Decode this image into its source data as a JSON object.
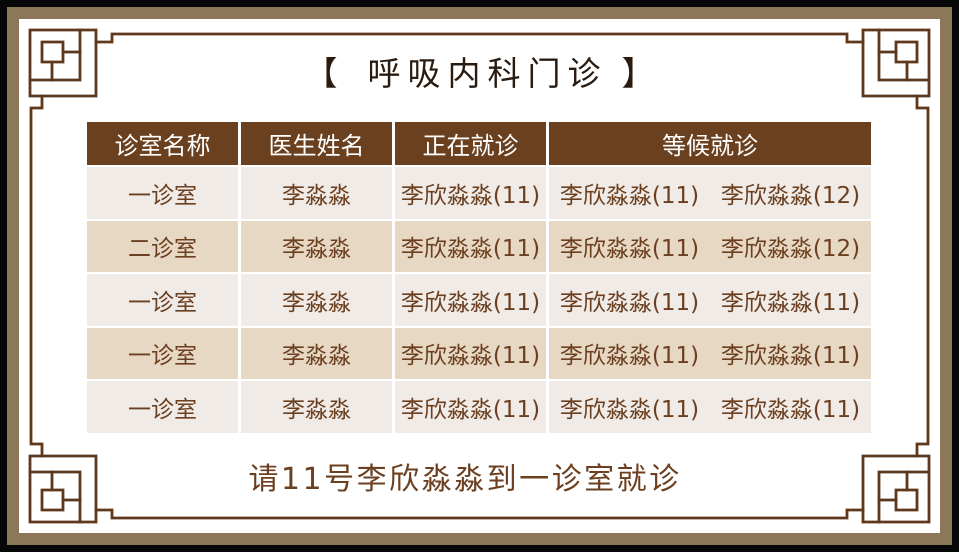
{
  "title": {
    "open_bracket": "【",
    "text": "呼吸内科门诊",
    "close_bracket": "】"
  },
  "table": {
    "columns": [
      "诊室名称",
      "医生姓名",
      "正在就诊",
      "等候就诊"
    ],
    "rows": [
      {
        "room": "一诊室",
        "doctor": "李淼淼",
        "current": "李欣淼淼(11)",
        "waiting": [
          "李欣淼淼(11)",
          "李欣淼淼(12)"
        ]
      },
      {
        "room": "二诊室",
        "doctor": "李淼淼",
        "current": "李欣淼淼(11)",
        "waiting": [
          "李欣淼淼(11)",
          "李欣淼淼(12)"
        ]
      },
      {
        "room": "一诊室",
        "doctor": "李淼淼",
        "current": "李欣淼淼(11)",
        "waiting": [
          "李欣淼淼(11)",
          "李欣淼淼(11)"
        ]
      },
      {
        "room": "一诊室",
        "doctor": "李淼淼",
        "current": "李欣淼淼(11)",
        "waiting": [
          "李欣淼淼(11)",
          "李欣淼淼(11)"
        ]
      },
      {
        "room": "一诊室",
        "doctor": "李淼淼",
        "current": "李欣淼淼(11)",
        "waiting": [
          "李欣淼淼(11)",
          "李欣淼淼(11)"
        ]
      }
    ]
  },
  "call_message": "请11号李欣淼淼到一诊室就诊",
  "colors": {
    "outer_border": "#080808",
    "band": "#8c7759",
    "panel": "#ffffff",
    "frame_line": "#5c391c",
    "title_text": "#2a1b11",
    "header_bg": "#6b401f",
    "header_text": "#ffffff",
    "body_text": "#6b3f1f",
    "row_light": "#f0ebe6",
    "row_dark": "#e7d8c4",
    "call_text": "#6b3f1f"
  }
}
